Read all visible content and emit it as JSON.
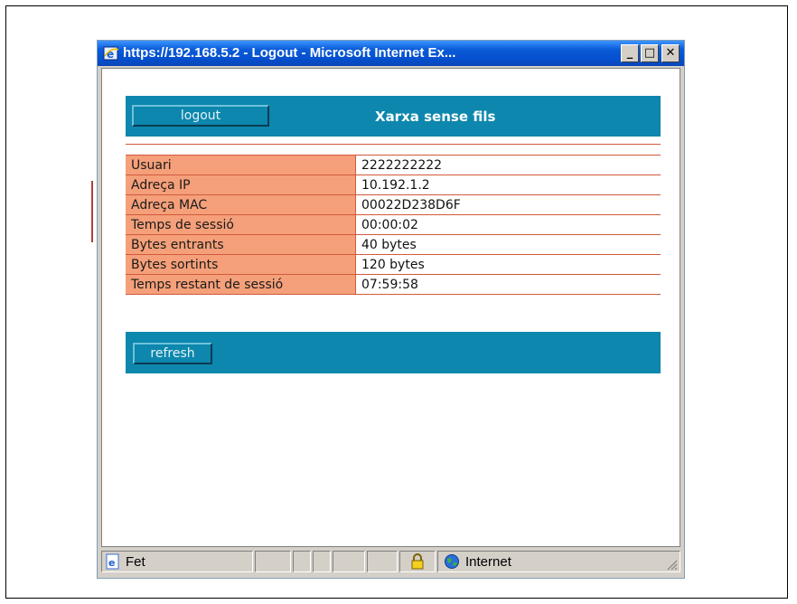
{
  "window": {
    "title": "https://192.168.5.2 - Logout - Microsoft Internet Ex...",
    "minimize": "_",
    "maximize": "□",
    "close": "✕"
  },
  "header": {
    "logout_label": "logout",
    "title": "Xarxa sense fils"
  },
  "info_rows": [
    {
      "label": "Usuari",
      "value": "2222222222"
    },
    {
      "label": "Adreça IP",
      "value": "10.192.1.2"
    },
    {
      "label": "Adreça MAC",
      "value": "00022D238D6F"
    },
    {
      "label": "Temps de sessió",
      "value": "00:00:02"
    },
    {
      "label": "Bytes entrants",
      "value": "40 bytes"
    },
    {
      "label": "Bytes sortints",
      "value": "120 bytes"
    },
    {
      "label": "Temps restant de sessió",
      "value": "07:59:58"
    }
  ],
  "footer": {
    "refresh_label": "refresh"
  },
  "statusbar": {
    "status": "Fet",
    "zone": "Internet"
  },
  "colors": {
    "bar": "#0d87ad",
    "label_bg": "#f5a07a",
    "border": "#d25a3c"
  }
}
